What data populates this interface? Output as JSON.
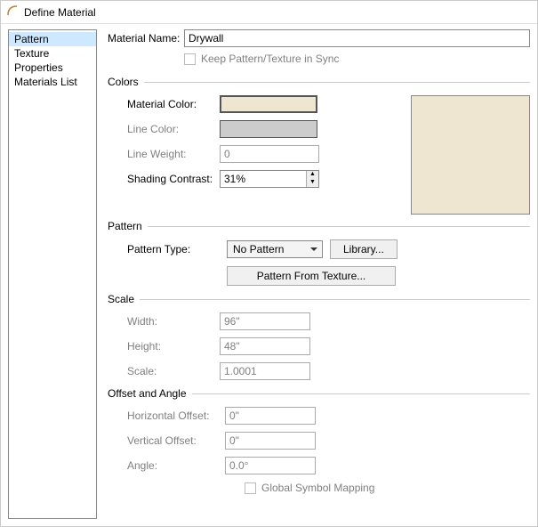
{
  "window": {
    "title": "Define Material"
  },
  "sidebar": {
    "items": [
      {
        "label": "Pattern",
        "selected": true
      },
      {
        "label": "Texture"
      },
      {
        "label": "Properties"
      },
      {
        "label": "Materials List"
      }
    ]
  },
  "fields": {
    "material_name_label": "Material Name:",
    "material_name_value": "Drywall",
    "keep_sync_label": "Keep Pattern/Texture in Sync"
  },
  "colors": {
    "title": "Colors",
    "material_color_label": "Material Color:",
    "material_color": "#eee6d0",
    "line_color_label": "Line Color:",
    "line_color": "#cccccc",
    "line_weight_label": "Line Weight:",
    "line_weight_value": "0",
    "shading_contrast_label": "Shading Contrast:",
    "shading_contrast_value": "31%"
  },
  "pattern": {
    "title": "Pattern",
    "type_label": "Pattern Type:",
    "type_value": "No Pattern",
    "library_btn": "Library...",
    "from_texture_btn": "Pattern From Texture..."
  },
  "scale": {
    "title": "Scale",
    "width_label": "Width:",
    "width_value": "96\"",
    "height_label": "Height:",
    "height_value": "48\"",
    "scale_label": "Scale:",
    "scale_value": "1.0001"
  },
  "offset": {
    "title": "Offset and Angle",
    "h_label": "Horizontal Offset:",
    "h_value": "0\"",
    "v_label": "Vertical Offset:",
    "v_value": "0\"",
    "angle_label": "Angle:",
    "angle_value": "0.0°",
    "global_label": "Global Symbol Mapping"
  }
}
